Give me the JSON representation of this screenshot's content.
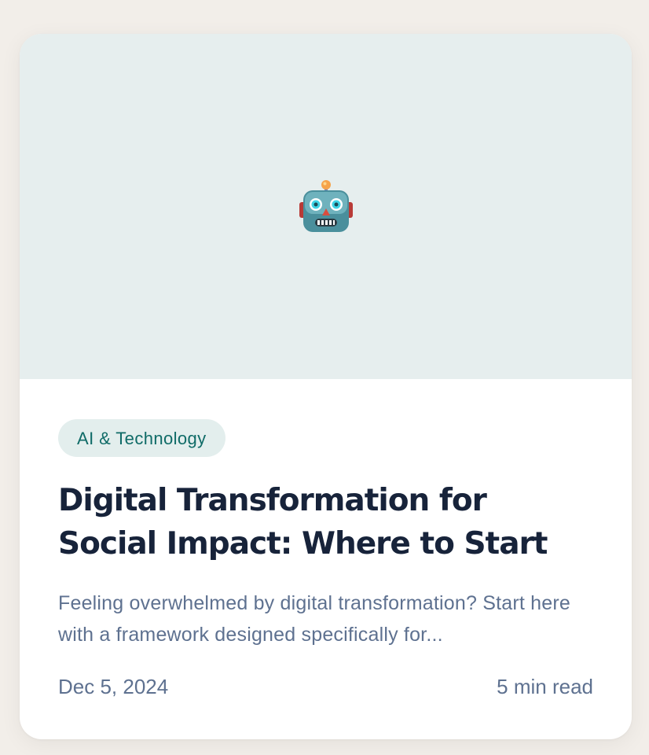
{
  "card": {
    "hero_icon": "robot-face-icon",
    "category": "AI & Technology",
    "title": "Digital Transformation for Social Impact: Where to Start",
    "excerpt": "Feeling overwhelmed by digital transformation? Start here with a framework designed specifically for...",
    "date": "Dec 5, 2024",
    "read_time": "5 min read"
  },
  "colors": {
    "page_background": "#f2eee9",
    "hero_background": "#e6eeee",
    "tag_background": "#e3eeed",
    "tag_text": "#0f6b67",
    "title_text": "#17233a",
    "muted_text": "#5e7190"
  }
}
